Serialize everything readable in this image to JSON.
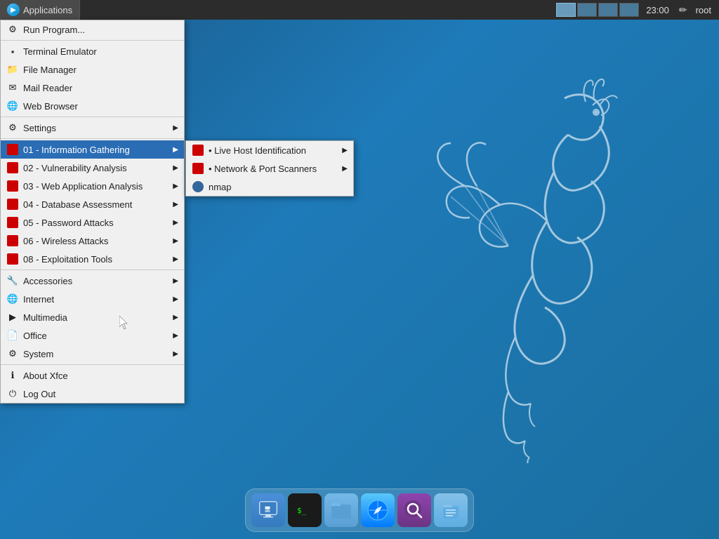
{
  "taskbar": {
    "app_button_label": "Applications",
    "time": "23:00",
    "user": "root",
    "workspaces": [
      "ws1",
      "ws2",
      "ws3",
      "ws4"
    ]
  },
  "menu": {
    "title": "Applications",
    "items": [
      {
        "id": "run-program",
        "label": "Run Program...",
        "icon": "gear",
        "has_arrow": false
      },
      {
        "id": "separator1",
        "type": "separator"
      },
      {
        "id": "terminal",
        "label": "Terminal Emulator",
        "icon": "terminal",
        "has_arrow": false
      },
      {
        "id": "file-manager",
        "label": "File Manager",
        "icon": "folder",
        "has_arrow": false
      },
      {
        "id": "mail-reader",
        "label": "Mail Reader",
        "icon": "mail",
        "has_arrow": false
      },
      {
        "id": "web-browser",
        "label": "Web Browser",
        "icon": "web",
        "has_arrow": false
      },
      {
        "id": "separator2",
        "type": "separator"
      },
      {
        "id": "settings",
        "label": "Settings",
        "icon": "settings",
        "has_arrow": true
      },
      {
        "id": "separator3",
        "type": "separator"
      },
      {
        "id": "info-gathering",
        "label": "01 - Information Gathering",
        "icon": "red",
        "has_arrow": true,
        "active": true
      },
      {
        "id": "vuln-analysis",
        "label": "02 - Vulnerability Analysis",
        "icon": "red",
        "has_arrow": true
      },
      {
        "id": "web-app",
        "label": "03 - Web Application Analysis",
        "icon": "red",
        "has_arrow": true
      },
      {
        "id": "db-assessment",
        "label": "04 - Database Assessment",
        "icon": "red",
        "has_arrow": true
      },
      {
        "id": "password",
        "label": "05 - Password Attacks",
        "icon": "red",
        "has_arrow": true
      },
      {
        "id": "wireless",
        "label": "06 - Wireless Attacks",
        "icon": "red",
        "has_arrow": true
      },
      {
        "id": "exploitation",
        "label": "08 - Exploitation Tools",
        "icon": "red",
        "has_arrow": true
      },
      {
        "id": "separator4",
        "type": "separator"
      },
      {
        "id": "accessories",
        "label": "Accessories",
        "icon": "accessories",
        "has_arrow": true
      },
      {
        "id": "internet",
        "label": "Internet",
        "icon": "internet",
        "has_arrow": true
      },
      {
        "id": "multimedia",
        "label": "Multimedia",
        "icon": "multimedia",
        "has_arrow": true
      },
      {
        "id": "office",
        "label": "Office",
        "icon": "office",
        "has_arrow": true
      },
      {
        "id": "system",
        "label": "System",
        "icon": "system",
        "has_arrow": true
      },
      {
        "id": "separator5",
        "type": "separator"
      },
      {
        "id": "about",
        "label": "About Xfce",
        "icon": "about",
        "has_arrow": false
      },
      {
        "id": "logout",
        "label": "Log Out",
        "icon": "logout",
        "has_arrow": false
      }
    ]
  },
  "submenu": {
    "parent": "01 - Information Gathering",
    "items": [
      {
        "id": "live-host",
        "label": "• Live Host Identification",
        "icon": "red",
        "has_arrow": true
      },
      {
        "id": "network-port",
        "label": "• Network & Port Scanners",
        "icon": "red",
        "has_arrow": true
      },
      {
        "id": "nmap",
        "label": "nmap",
        "icon": "eye",
        "has_arrow": false
      }
    ]
  },
  "dock": {
    "items": [
      {
        "id": "monitor",
        "label": "Remote Desktop",
        "symbol": "🖥"
      },
      {
        "id": "terminal",
        "label": "Terminal",
        "symbol": "$_"
      },
      {
        "id": "folder",
        "label": "File Manager",
        "symbol": "📁"
      },
      {
        "id": "browser",
        "label": "Browser",
        "symbol": "🧭"
      },
      {
        "id": "search",
        "label": "Search",
        "symbol": "🔍"
      },
      {
        "id": "files",
        "label": "Files",
        "symbol": "📂"
      }
    ]
  }
}
